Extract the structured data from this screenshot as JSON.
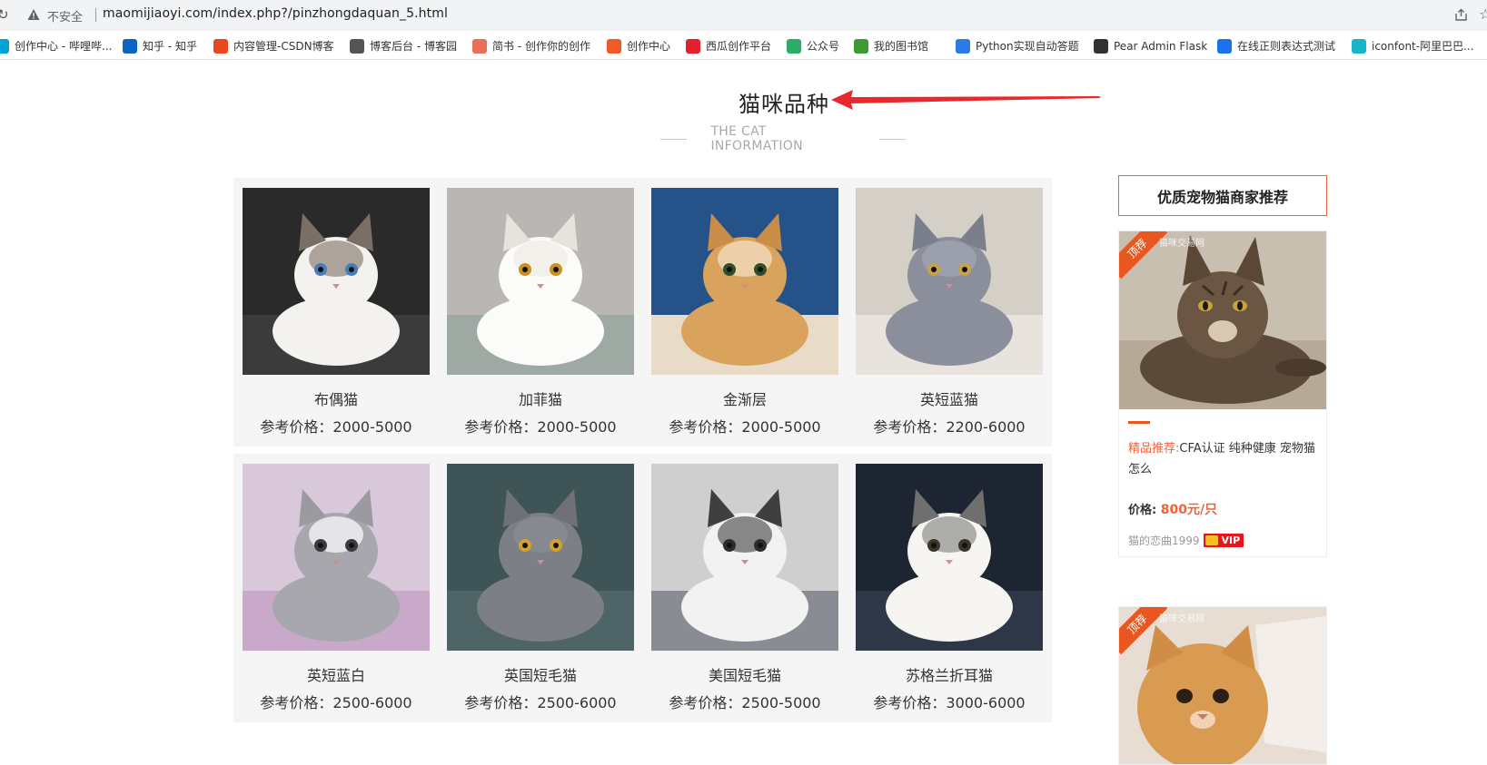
{
  "browser": {
    "security_label": "不安全",
    "url": "maomijiaoyi.com/index.php?/pinzhongdaquan_5.html",
    "bookmarks": [
      {
        "label": "创作中心 - 哔哩哔...",
        "icon": "bilibili-icon",
        "color": "#00a1d6"
      },
      {
        "label": "知乎 - 知乎",
        "icon": "zhihu-icon",
        "color": "#0a66c2"
      },
      {
        "label": "内容管理-CSDN博客",
        "icon": "csdn-icon",
        "color": "#e8471f"
      },
      {
        "label": "博客后台 - 博客园",
        "icon": "cnblogs-icon",
        "color": "#555555"
      },
      {
        "label": "简书 - 创作你的创作",
        "icon": "jianshu-icon",
        "color": "#ea6f5a"
      },
      {
        "label": "创作中心",
        "icon": "creator-icon",
        "color": "#f05a28"
      },
      {
        "label": "西瓜创作平台",
        "icon": "xigua-icon",
        "color": "#e5202e"
      },
      {
        "label": "公众号",
        "icon": "wechat-icon",
        "color": "#2aae67"
      },
      {
        "label": "我的图书馆",
        "icon": "library-icon",
        "color": "#3d9a32"
      },
      {
        "label": "Python实现自动答题",
        "icon": "python-icon",
        "color": "#2c7be5"
      },
      {
        "label": "Pear Admin Flask",
        "icon": "github-icon",
        "color": "#333333"
      },
      {
        "label": "在线正则表达式测试",
        "icon": "regex-icon",
        "color": "#1a73e8"
      },
      {
        "label": "iconfont-阿里巴巴...",
        "icon": "iconfont-icon",
        "color": "#18b4c7"
      }
    ]
  },
  "page": {
    "title": "猫咪品种",
    "subtitle": "THE CAT INFORMATION"
  },
  "cats": [
    {
      "name": "布偶猫",
      "price": "参考价格：2000-5000"
    },
    {
      "name": "加菲猫",
      "price": "参考价格：2000-5000"
    },
    {
      "name": "金渐层",
      "price": "参考价格：2000-5000"
    },
    {
      "name": "英短蓝猫",
      "price": "参考价格：2200-6000"
    },
    {
      "name": "英短蓝白",
      "price": "参考价格：2500-6000"
    },
    {
      "name": "英国短毛猫",
      "price": "参考价格：2500-6000"
    },
    {
      "name": "美国短毛猫",
      "price": "参考价格：2500-5000"
    },
    {
      "name": "苏格兰折耳猫",
      "price": "参考价格：3000-6000"
    }
  ],
  "sidebar": {
    "title": "优质宠物猫商家推荐",
    "ribbon": "顶荐",
    "site_mark": "猫咪交易网",
    "listing": {
      "highlight": "精品推荐:",
      "desc": "CFA认证 纯种健康 宠物猫怎么",
      "price_label": "价格:",
      "price_value": "800元/只",
      "seller": "猫的恋曲1999",
      "vip": "VIP"
    },
    "ribbon2": "顶荐"
  }
}
